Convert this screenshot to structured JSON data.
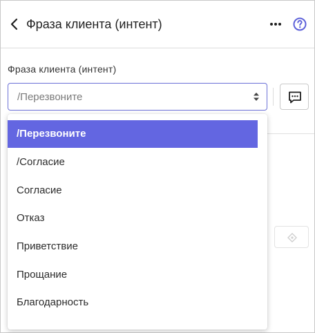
{
  "header": {
    "title": "Фраза клиента (интент)",
    "back_icon": "chevron-left-icon",
    "more_icon": "more-horizontal-icon",
    "help_icon": "help-circle-icon",
    "accent_color": "#6366e1"
  },
  "field": {
    "label": "Фраза клиента (интент)",
    "value": "/Перезвоните"
  },
  "dropdown": {
    "options": [
      {
        "label": "/Перезвоните",
        "selected": true
      },
      {
        "label": "/Согласие",
        "selected": false
      },
      {
        "label": "Согласие",
        "selected": false
      },
      {
        "label": "Отказ",
        "selected": false
      },
      {
        "label": "Приветствие",
        "selected": false
      },
      {
        "label": "Прощание",
        "selected": false
      },
      {
        "label": "Благодарность",
        "selected": false
      }
    ]
  }
}
